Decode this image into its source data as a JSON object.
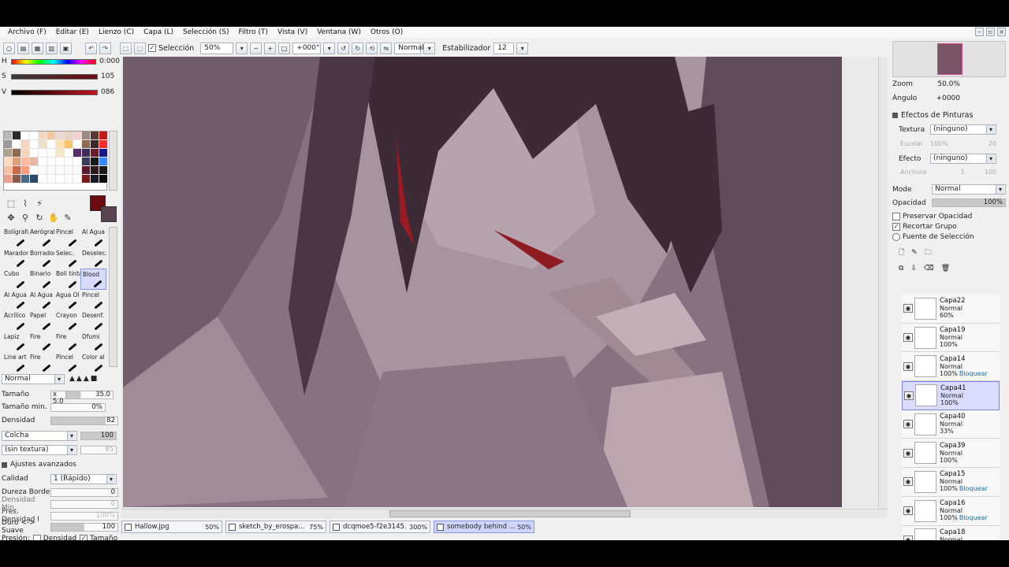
{
  "menu": [
    "Archivo (F)",
    "Editar (E)",
    "Lienzo (C)",
    "Capa (L)",
    "Selección (S)",
    "Filtro (T)",
    "Vista (V)",
    "Ventana (W)",
    "Otros (O)"
  ],
  "toolbar": {
    "seleccion_label": "Selección",
    "zoom": "50%",
    "rotation": "+000°",
    "blend": "Normal",
    "stabilizer_label": "Estabilizador",
    "stabilizer_value": "12"
  },
  "color": {
    "h_label": "H",
    "h_value": "0:000",
    "s_label": "S",
    "s_value": "105",
    "v_label": "V",
    "v_value": "086",
    "primary": "#6b0a10",
    "secondary": "#5a4652"
  },
  "brushes": [
    "Bolígrafo",
    "Aerógraf",
    "Pincel",
    "Al Agua",
    "Marador",
    "Borrador",
    "Selec.",
    "Deselec.",
    "Cubo",
    "Binario",
    "Boli tinta",
    "Blood",
    "Al Agua 9",
    "Al Agua 10",
    "Agua Ol",
    "Pincel",
    "Acrílico",
    "Papel",
    "Crayon",
    "Desenf.",
    "Lapiz",
    "Fire",
    "Fire",
    "Dfumi",
    "Line art",
    "Fire",
    "Pincel",
    "Color al"
  ],
  "brush_selected_index": 11,
  "brush_props": {
    "blend": "Normal",
    "tamano_label": "Tamaño",
    "tamano_mult": "x 5.0",
    "tamano_value": "35.0",
    "tamano_min_label": "Tamaño min.",
    "tamano_min_value": "0%",
    "densidad_label": "Densidad",
    "densidad_value": "82",
    "colcha_label": "Colcha",
    "colcha_value": "100",
    "textura": "(sin textura)",
    "textura_value": "95",
    "avanzados_label": "Ajustes avanzados",
    "calidad_label": "Calidad",
    "calidad_value": "1 (Rápido)",
    "dureza_label": "Dureza Borde",
    "dureza_value": "0",
    "densidad_min_label": "Densidad Min.",
    "densidad_min_value": "0",
    "pres_densidad_label": "Pres. Densidad l",
    "pres_densidad_value": "100%",
    "duro_label": "Duro <-> Suave",
    "duro_value": "100",
    "presion_label": "Presión:",
    "presion_densidad": "Densidad",
    "presion_tamano": "Tamaño"
  },
  "tabs": [
    {
      "name": "Hallow.jpg",
      "zoom": "50%"
    },
    {
      "name": "sketch_by_erospa...",
      "zoom": "75%"
    },
    {
      "name": "dcqmoe5-f2e3145...",
      "zoom": "300%"
    },
    {
      "name": "somebody behind ...",
      "zoom": "50%"
    }
  ],
  "navigator": {
    "zoom_label": "Zoom",
    "zoom_value": "50.0%",
    "angle_label": "Ángulo",
    "angle_value": "+0000"
  },
  "paint_effects": {
    "title": "Efectos de Pinturas",
    "textura_label": "Textura",
    "textura_value": "(ninguno)",
    "escalar_label": "Escalar",
    "escalar_value": "100%",
    "escalar_num": "20",
    "efecto_label": "Efecto",
    "efecto_value": "(ninguno)",
    "anchura_label": "Anchura",
    "anchura_value": "1",
    "anchura_num": "100"
  },
  "layer_props": {
    "mode_label": "Mode",
    "mode_value": "Normal",
    "opacity_label": "Opacidad",
    "opacity_value": "100%",
    "preservar": "Preservar Opacidad",
    "recortar": "Recortar Grupo",
    "fuente": "Fuente de Selección"
  },
  "layers": [
    {
      "name": "Capa22",
      "mode": "Normal",
      "opacity": "60%",
      "extra": "",
      "clip": true
    },
    {
      "name": "Capa19",
      "mode": "Normal",
      "opacity": "100%",
      "extra": "",
      "clip": true
    },
    {
      "name": "Capa14",
      "mode": "Normal",
      "opacity": "100%",
      "extra": "Bloquear",
      "clip": false
    },
    {
      "name": "Capa41",
      "mode": "Normal",
      "opacity": "100%",
      "extra": "",
      "clip": true
    },
    {
      "name": "Capa40",
      "mode": "Normal",
      "opacity": "33%",
      "extra": "",
      "clip": true
    },
    {
      "name": "Capa39",
      "mode": "Normal",
      "opacity": "100%",
      "extra": "",
      "clip": true
    },
    {
      "name": "Capa15",
      "mode": "Normal",
      "opacity": "100%",
      "extra": "Bloquear",
      "clip": false
    },
    {
      "name": "Capa16",
      "mode": "Normal",
      "opacity": "100%",
      "extra": "Bloquear",
      "clip": true
    },
    {
      "name": "Capa18",
      "mode": "Normal",
      "opacity": "",
      "extra": "",
      "clip": true
    }
  ],
  "layer_selected_index": 3
}
